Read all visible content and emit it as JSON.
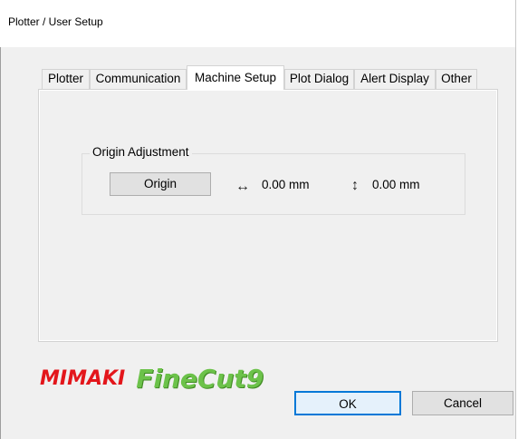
{
  "window": {
    "title": "Plotter / User Setup"
  },
  "tabs": [
    {
      "label": "Plotter",
      "active": false
    },
    {
      "label": "Communication",
      "active": false
    },
    {
      "label": "Machine Setup",
      "active": true
    },
    {
      "label": "Plot Dialog",
      "active": false
    },
    {
      "label": "Alert Display",
      "active": false
    },
    {
      "label": "Other",
      "active": false
    }
  ],
  "origin_adjustment": {
    "legend": "Origin Adjustment",
    "button_label": "Origin",
    "horizontal_value": "0.00 mm",
    "vertical_value": "0.00 mm",
    "horizontal_icon": "left-right-arrow-icon",
    "vertical_icon": "up-down-arrow-icon"
  },
  "brand": {
    "mimaki": "MIMAKI",
    "finecut": "FineCut9",
    "mimaki_color": "#e3161b",
    "finecut_color": "#6cc24a"
  },
  "footer": {
    "ok_label": "OK",
    "cancel_label": "Cancel"
  }
}
